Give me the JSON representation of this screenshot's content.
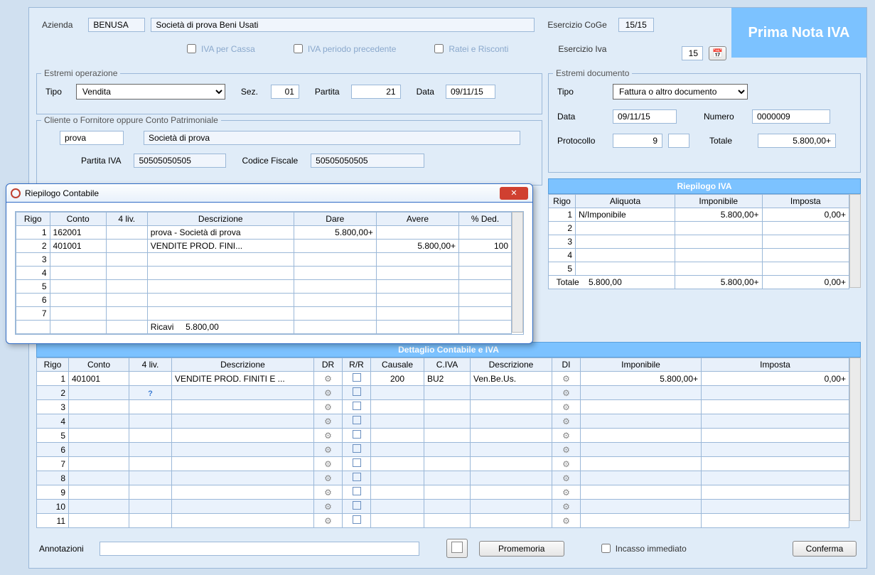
{
  "title_badge": "Prima Nota IVA",
  "header": {
    "azienda_lbl": "Azienda",
    "azienda_code": "BENUSA",
    "azienda_name": "Società di prova Beni Usati",
    "esercizio_coge_lbl": "Esercizio CoGe",
    "esercizio_coge": "15/15",
    "esercizio_iva_lbl": "Esercizio Iva",
    "esercizio_iva": "15",
    "chk_iva_cassa": "IVA per Cassa",
    "chk_iva_periodo": "IVA periodo precedente",
    "chk_ratei": "Ratei e Risconti"
  },
  "estremi_op": {
    "group": "Estremi operazione",
    "tipo_lbl": "Tipo",
    "tipo_val": "Vendita",
    "sez_lbl": "Sez.",
    "sez_val": "01",
    "partita_lbl": "Partita",
    "partita_val": "21",
    "data_lbl": "Data",
    "data_val": "09/11/15"
  },
  "estremi_doc": {
    "group": "Estremi documento",
    "tipo_lbl": "Tipo",
    "tipo_val": "Fattura o altro documento",
    "data_lbl": "Data",
    "data_val": "09/11/15",
    "numero_lbl": "Numero",
    "numero_val": "0000009",
    "protocollo_lbl": "Protocollo",
    "protocollo_val": "9",
    "totale_lbl": "Totale",
    "totale_val": "5.800,00+"
  },
  "cliente": {
    "group": "Cliente o Fornitore oppure Conto Patrimoniale",
    "code": "prova",
    "name": "Società di prova",
    "piva_lbl": "Partita IVA",
    "piva_val": "50505050505",
    "cf_lbl": "Codice Fiscale",
    "cf_val": "50505050505"
  },
  "riepilogo_iva": {
    "title": "Riepilogo IVA",
    "headers": [
      "Rigo",
      "Aliquota",
      "Imponibile",
      "Imposta"
    ],
    "rows": [
      {
        "rigo": "1",
        "aliquota": "N/Imponibile",
        "imponibile": "5.800,00+",
        "imposta": "0,00+"
      },
      {
        "rigo": "2",
        "aliquota": "",
        "imponibile": "",
        "imposta": ""
      },
      {
        "rigo": "3",
        "aliquota": "",
        "imponibile": "",
        "imposta": ""
      },
      {
        "rigo": "4",
        "aliquota": "",
        "imponibile": "",
        "imposta": ""
      },
      {
        "rigo": "5",
        "aliquota": "",
        "imponibile": "",
        "imposta": ""
      }
    ],
    "footer": {
      "label": "Totale",
      "tot": "5.800,00",
      "imponibile": "5.800,00+",
      "imposta": "0,00+"
    }
  },
  "dettaglio": {
    "title": "Dettaglio Contabile e IVA",
    "headers": [
      "Rigo",
      "Conto",
      "4 liv.",
      "Descrizione",
      "DR",
      "R/R",
      "Causale",
      "C.IVA",
      "Descrizione",
      "DI",
      "Imponibile",
      "Imposta"
    ],
    "rows": [
      {
        "rigo": "1",
        "conto": "401001",
        "liv4": "",
        "desc": "VENDITE PROD. FINITI E ...",
        "causale": "200",
        "civa": "BU2",
        "desc2": "Ven.Be.Us.",
        "imponibile": "5.800,00+",
        "imposta": "0,00+"
      },
      {
        "rigo": "2"
      },
      {
        "rigo": "3"
      },
      {
        "rigo": "4"
      },
      {
        "rigo": "5"
      },
      {
        "rigo": "6"
      },
      {
        "rigo": "7"
      },
      {
        "rigo": "8"
      },
      {
        "rigo": "9"
      },
      {
        "rigo": "10"
      },
      {
        "rigo": "11"
      }
    ]
  },
  "footer": {
    "annotazioni_lbl": "Annotazioni",
    "promemoria": "Promemoria",
    "incasso": "Incasso immediato",
    "conferma": "Conferma"
  },
  "modal": {
    "title": "Riepilogo Contabile",
    "headers": [
      "Rigo",
      "Conto",
      "4 liv.",
      "Descrizione",
      "Dare",
      "Avere",
      "% Ded."
    ],
    "rows": [
      {
        "rigo": "1",
        "conto": "162001",
        "liv4": "",
        "desc": "prova  - Società di prova",
        "dare": "5.800,00+",
        "avere": "",
        "ded": ""
      },
      {
        "rigo": "2",
        "conto": "401001",
        "liv4": "",
        "desc": "VENDITE PROD. FINI...",
        "dare": "",
        "avere": "5.800,00+",
        "ded": "100"
      },
      {
        "rigo": "3"
      },
      {
        "rigo": "4"
      },
      {
        "rigo": "5"
      },
      {
        "rigo": "6"
      },
      {
        "rigo": "7"
      }
    ],
    "footer_label": "Ricavi",
    "footer_val": "5.800,00"
  }
}
